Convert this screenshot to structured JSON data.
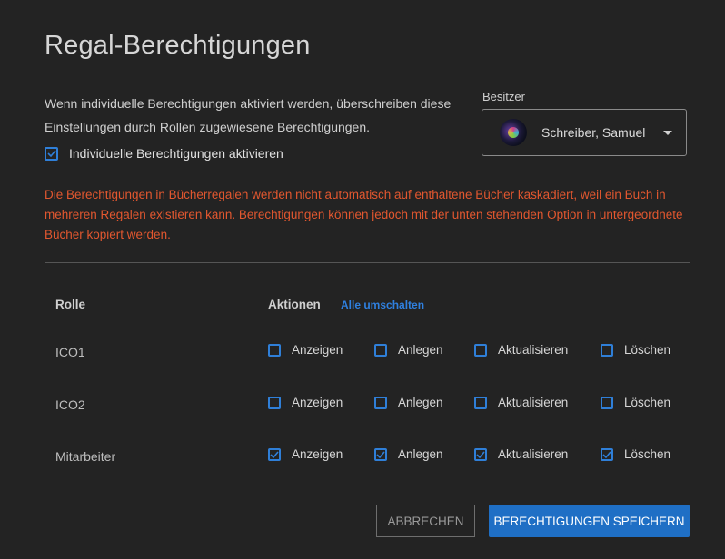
{
  "dialog": {
    "title": "Regal-Berechtigungen",
    "intro": "Wenn individuelle Berechtigungen aktiviert werden, überschreiben diese Einstellungen durch Rollen zugewiesene Berechtigungen.",
    "enable_label": "Individuelle Berechtigungen aktivieren",
    "enable_checked": true,
    "warning": "Die Berechtigungen in Bücherregalen werden nicht automatisch auf enthaltene Bücher kaskadiert, weil ein Buch in mehreren Regalen existieren kann. Berechtigungen können jedoch mit der unten stehenden Option in untergeordnete Bücher kopiert werden."
  },
  "owner": {
    "label": "Besitzer",
    "name": "Schreiber, Samuel"
  },
  "table": {
    "role_header": "Rolle",
    "actions_header": "Aktionen",
    "toggle_all": "Alle umschalten",
    "action_labels": [
      "Anzeigen",
      "Anlegen",
      "Aktualisieren",
      "Löschen"
    ],
    "rows": [
      {
        "role": "ICO1",
        "checked": [
          false,
          false,
          false,
          false
        ]
      },
      {
        "role": "ICO2",
        "checked": [
          false,
          false,
          false,
          false
        ]
      },
      {
        "role": "Mitarbeiter",
        "checked": [
          true,
          true,
          true,
          true
        ]
      }
    ]
  },
  "buttons": {
    "cancel": "ABBRECHEN",
    "save": "BERECHTIGUNGEN SPEICHERN"
  },
  "colors": {
    "accent": "#1f6fc5",
    "warning": "#e2572f",
    "background": "#232323"
  },
  "icons": {
    "checkmark": "check-icon",
    "dropdown": "chevron-down-icon"
  }
}
